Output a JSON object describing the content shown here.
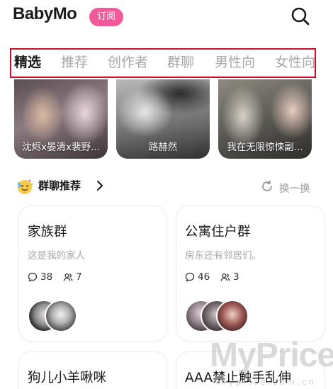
{
  "header": {
    "logo": "BabyMo",
    "subscribe_label": "订阅"
  },
  "tabs": [
    {
      "label": "精选",
      "active": true
    },
    {
      "label": "推荐",
      "active": false
    },
    {
      "label": "创作者",
      "active": false
    },
    {
      "label": "群聊",
      "active": false
    },
    {
      "label": "男性向",
      "active": false
    },
    {
      "label": "女性向",
      "active": false
    }
  ],
  "banners": [
    {
      "caption": "沈烬x晏清x裴野..."
    },
    {
      "caption": "路赫然"
    },
    {
      "caption": "我在无限惊悚副..."
    }
  ],
  "group_section": {
    "title": "群聊推荐",
    "refresh_label": "换一换",
    "cards": [
      {
        "name": "家族群",
        "desc": "这是我的家人",
        "messages": "38",
        "members": "7"
      },
      {
        "name": "公寓住户群",
        "desc": "房东还有邻居们。",
        "messages": "46",
        "members": "3"
      },
      {
        "name": "狗儿小羊啾咪",
        "desc": "",
        "messages": "",
        "members": ""
      },
      {
        "name": "AAA禁止触手乱伸",
        "desc": "",
        "messages": "",
        "members": ""
      }
    ]
  },
  "watermark": {
    "text": "MyPrice",
    "url": "myprice.com.cn"
  },
  "colors": {
    "accent_pink": "#f25a9a",
    "tab_border": "#c8102e",
    "tab_active": "#1a1a1a",
    "tab_inactive": "#a8a8a8"
  }
}
